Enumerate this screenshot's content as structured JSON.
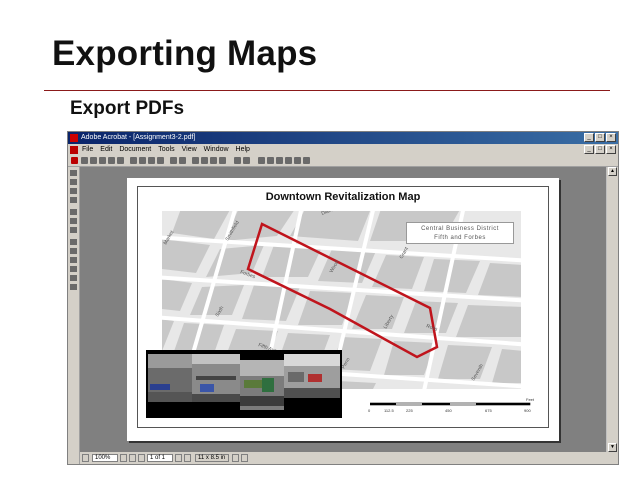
{
  "slide": {
    "title": "Exporting Maps",
    "subtitle": "Export PDFs"
  },
  "window": {
    "title": "Adobe Acrobat - [Assignment3-2.pdf]",
    "minimize": "_",
    "maximize": "□",
    "close": "×",
    "menu": [
      "File",
      "Edit",
      "Document",
      "Tools",
      "View",
      "Window",
      "Help"
    ]
  },
  "status": {
    "zoom": "100%",
    "page": "1 of 1",
    "page_size": "11 x 8.5 in"
  },
  "map": {
    "title": "Downtown Revitalization Map",
    "legend_line1": "Central Business District",
    "legend_line2": "Fifth and Forbes",
    "scale_ticks": [
      "0",
      "112.5",
      "225",
      "450",
      "675",
      "900"
    ],
    "scale_unit": "Feet"
  },
  "colors": {
    "accent_rule": "#8b1a1a",
    "district_outline": "#c0141c",
    "street_gray": "#c8c8c8"
  }
}
